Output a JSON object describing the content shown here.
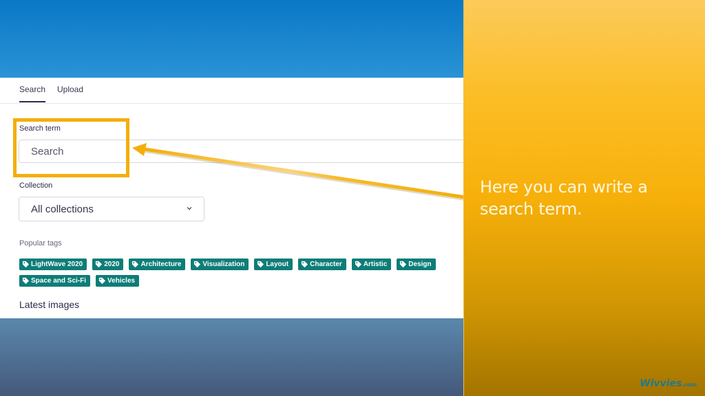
{
  "app": {
    "tabs": [
      {
        "label": "Search",
        "active": true
      },
      {
        "label": "Upload",
        "active": false
      }
    ],
    "search": {
      "label": "Search term",
      "placeholder": "Search",
      "value": ""
    },
    "collection": {
      "label": "Collection",
      "selected": "All collections",
      "icon": "chevron-down-icon"
    },
    "popular_tags": {
      "label": "Popular tags",
      "icon": "tag-icon",
      "color": "#0d7d78",
      "items": [
        "LightWave 2020",
        "2020",
        "Architecture",
        "Visualization",
        "Layout",
        "Character",
        "Artistic",
        "Design",
        "Space and Sci-Fi",
        "Vehicles"
      ]
    },
    "latest_images": {
      "title": "Latest images"
    }
  },
  "annotation": {
    "highlight_color": "#f4ae0a",
    "callout_text": "Here you can write a search term.",
    "brand": "Wivvies",
    "brand_suffix": ".com"
  }
}
